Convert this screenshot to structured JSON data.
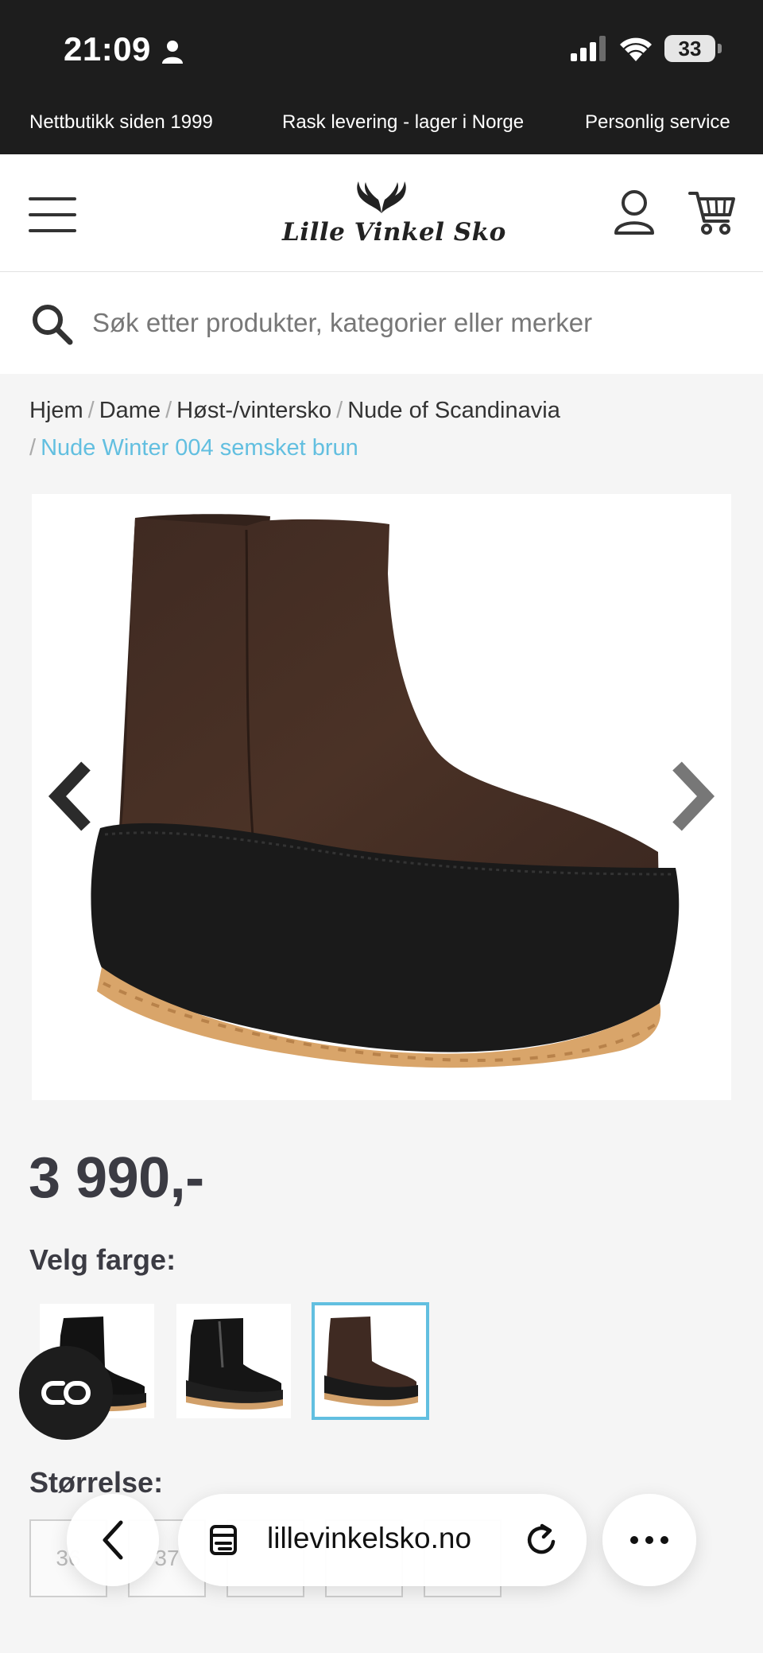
{
  "status_bar": {
    "time": "21:09",
    "battery": "33"
  },
  "usp_bar": {
    "items": [
      "Nettbutikk siden 1999",
      "Rask levering - lager i Norge",
      "Personlig service"
    ]
  },
  "header": {
    "logo_text": "Lille Vinkel Sko"
  },
  "search": {
    "placeholder": "Søk etter produkter, kategorier eller merker"
  },
  "breadcrumb": {
    "items": [
      "Hjem",
      "Dame",
      "Høst-/vintersko",
      "Nude of Scandinavia"
    ],
    "current": "Nude Winter 004 semsket brun"
  },
  "product": {
    "price": "3 990,-",
    "color_label": "Velg farge:",
    "size_label": "Størrelse:",
    "sizes": [
      "36",
      "37",
      "",
      "",
      ""
    ]
  },
  "browser": {
    "url": "lillevinkelsko.no"
  },
  "colors": {
    "accent": "#62bfe0",
    "dark": "#1d1d1d",
    "text": "#3b3b43"
  }
}
